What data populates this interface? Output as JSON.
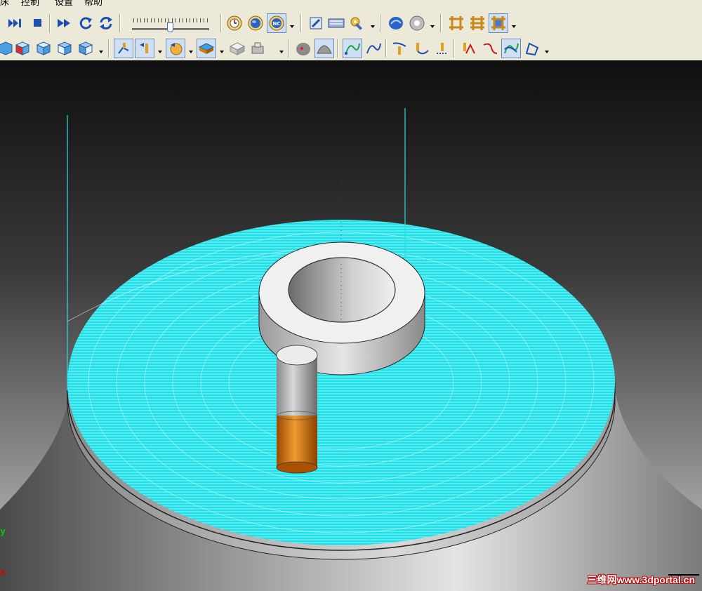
{
  "menu": {
    "items": [
      "床",
      "控制",
      "设置",
      "帮助"
    ]
  },
  "toolbar1": {
    "buttons": [
      {
        "icon": "step-end-icon"
      },
      {
        "icon": "stop-icon"
      },
      {
        "icon": "fast-forward-icon"
      },
      {
        "icon": "reload-icon"
      },
      {
        "icon": "refresh-icon"
      },
      {
        "icon": "speed-slider"
      },
      {
        "icon": "clock-icon"
      },
      {
        "icon": "globe-icon"
      },
      {
        "icon": "nc-icon",
        "label": "NC"
      },
      {
        "icon": "edit-icon"
      },
      {
        "icon": "keyboard-icon"
      },
      {
        "icon": "wrench-icon"
      },
      {
        "icon": "shape-icon"
      },
      {
        "icon": "sphere-icon"
      },
      {
        "icon": "grid-icon-a"
      },
      {
        "icon": "grid-icon-b"
      },
      {
        "icon": "grid-icon-c"
      }
    ]
  },
  "toolbar2": {
    "buttons": [
      {
        "icon": "cube-front-icon"
      },
      {
        "icon": "cube-red-icon"
      },
      {
        "icon": "cube-top-icon"
      },
      {
        "icon": "cube-side-icon"
      },
      {
        "icon": "cube-iso-icon"
      },
      {
        "icon": "tool-axis-icon"
      },
      {
        "icon": "tool-holder-icon"
      },
      {
        "icon": "tool-path-icon"
      },
      {
        "icon": "stock-icon"
      },
      {
        "icon": "box-icon"
      },
      {
        "icon": "fixture-icon"
      },
      {
        "icon": "cone-icon"
      },
      {
        "icon": "half-sphere-icon"
      },
      {
        "icon": "path-green-icon"
      },
      {
        "icon": "path-blue-icon"
      },
      {
        "icon": "tool-a-icon"
      },
      {
        "icon": "tool-b-icon"
      },
      {
        "icon": "tool-c-icon"
      },
      {
        "icon": "path-c-icon"
      },
      {
        "icon": "path-d-icon"
      },
      {
        "icon": "path-e-icon"
      },
      {
        "icon": "path-f-icon"
      }
    ]
  },
  "viewport": {
    "axis_y_label": "y",
    "axis_x_label": "x",
    "watermark": "三维网www.3dportal.cn"
  },
  "colors": {
    "toolpath": "#1ee0e8",
    "stock_top": "#f0f0f0",
    "tool_shank": "#b8b8b8",
    "tool_cutter": "#d2700d",
    "background_dark": "#0f0f0f",
    "ui_face": "#ece9d8"
  }
}
